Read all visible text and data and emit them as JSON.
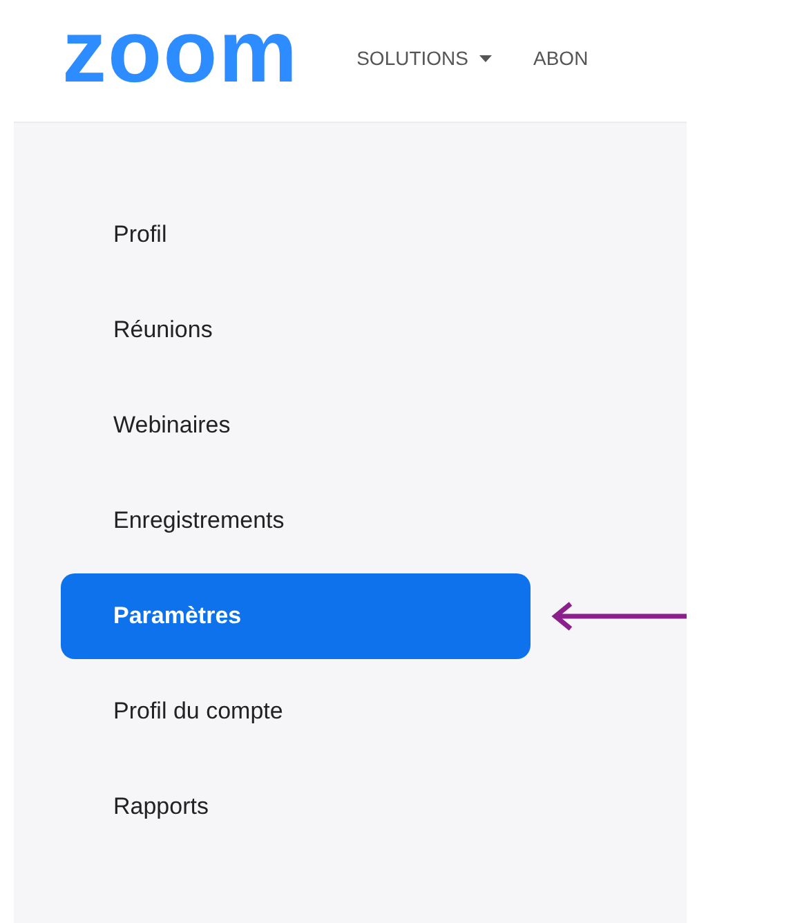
{
  "header": {
    "logo": "zoom",
    "nav": [
      {
        "label": "SOLUTIONS",
        "dropdown": true
      },
      {
        "label": "ABON",
        "dropdown": false
      }
    ]
  },
  "sidebar": {
    "items": [
      {
        "label": "Profil",
        "selected": false
      },
      {
        "label": "Réunions",
        "selected": false
      },
      {
        "label": "Webinaires",
        "selected": false
      },
      {
        "label": "Enregistrements",
        "selected": false
      },
      {
        "label": "Paramètres",
        "selected": true
      },
      {
        "label": "Profil du compte",
        "selected": false
      },
      {
        "label": "Rapports",
        "selected": false
      }
    ]
  }
}
